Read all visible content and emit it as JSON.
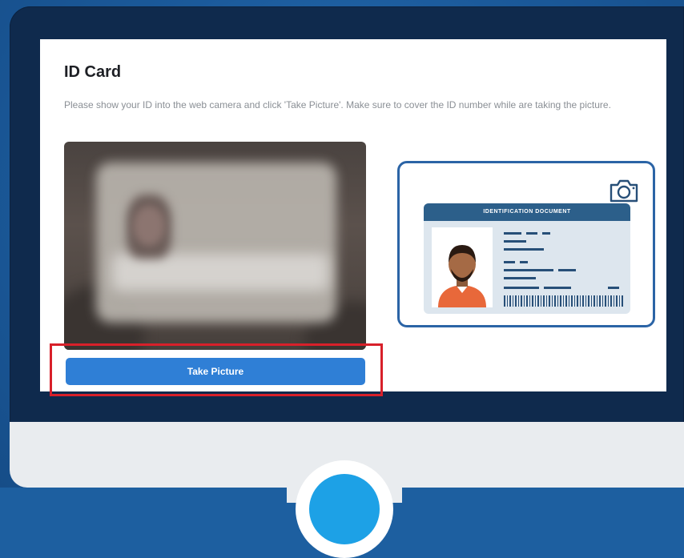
{
  "page": {
    "title": "ID Card",
    "instructions": "Please show your ID into the web camera and click 'Take Picture'. Make sure to cover the ID number while are taking the picture."
  },
  "camera": {
    "take_picture_label": "Take Picture"
  },
  "illustration": {
    "id_header": "IDENTIFICATION DOCUMENT",
    "icon": "camera-icon"
  },
  "colors": {
    "background": "#1d5fa0",
    "monitor_frame": "#0f2a4d",
    "button": "#2f7fd6",
    "highlight": "#d8202a",
    "id_header": "#2c5f8a",
    "home_button": "#1da1e6"
  }
}
